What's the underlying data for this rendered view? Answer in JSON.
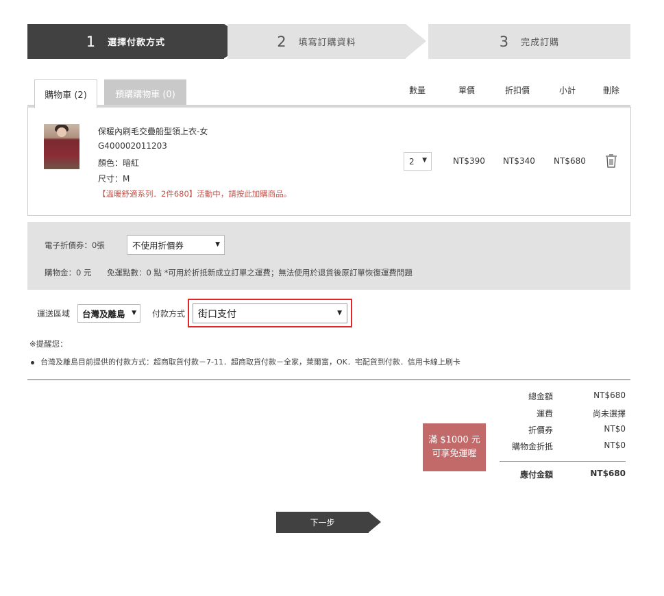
{
  "steps": [
    {
      "num": "1",
      "label": "選擇付款方式"
    },
    {
      "num": "2",
      "label": "填寫訂購資料"
    },
    {
      "num": "3",
      "label": "完成訂購"
    }
  ],
  "tabs": {
    "cart": "購物車 (2)",
    "preorder": "預購購物車 (0)"
  },
  "columns": {
    "qty": "數量",
    "unit_price": "單價",
    "discount_price": "折扣價",
    "subtotal": "小計",
    "delete": "刪除"
  },
  "item": {
    "name": "保暖內刷毛交疊船型領上衣-女",
    "sku": "G400002011203",
    "color": "顏色：暗紅",
    "size": "尺寸：M",
    "promo": "【溫暖舒適系列．2件680】活動中，請按此加購商品。",
    "qty": "2",
    "unit_price": "NT$390",
    "discount_price": "NT$340",
    "subtotal": "NT$680"
  },
  "coupon": {
    "ecoupon_label": "電子折價券：0張",
    "select_value": "不使用折價券",
    "shopping_credit": "購物金：0 元",
    "shipping_points": "免運點數：0 點 *可用於折抵新成立訂單之運費；無法使用於退貨後原訂單恢復運費問題"
  },
  "shipping": {
    "region_label": "運送區域",
    "region_value": "台灣及離島",
    "payment_label": "付款方式",
    "payment_value": "街口支付"
  },
  "reminder": {
    "title": "※提醒您：",
    "item": "台灣及離島目前提供的付款方式：超商取貨付款－7-11．超商取貨付款－全家，萊爾富，OK．宅配貨到付款．信用卡線上刷卡"
  },
  "free_shipping": {
    "line1": "滿 $1000 元",
    "line2": "可享免運喔"
  },
  "totals": {
    "total_label": "總金額",
    "total_value": "NT$680",
    "freight_label": "運費",
    "freight_value": "尚未選擇",
    "coupon_label": "折價券",
    "coupon_value": "NT$0",
    "credit_label": "購物金折抵",
    "credit_value": "NT$0",
    "payable_label": "應付金額",
    "payable_value": "NT$680"
  },
  "next_button": "下一步"
}
